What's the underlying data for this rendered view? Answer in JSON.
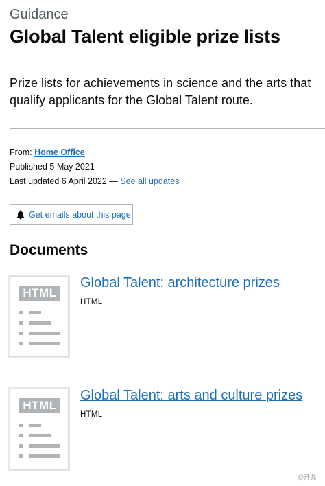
{
  "header": {
    "caption": "Guidance",
    "title": "Global Talent eligible prize lists",
    "lead": "Prize lists for achievements in science and the arts that qualify applicants for the Global Talent route."
  },
  "metadata": {
    "from_label": "From:",
    "from_link": "Home Office",
    "published_label": "Published",
    "published_date": "5 May 2021",
    "updated_label": "Last updated",
    "updated_date": "6 April 2022",
    "updated_separator": "—",
    "see_all_updates": "See all updates"
  },
  "email_button": {
    "icon": "bell-icon",
    "label": "Get emails about this page"
  },
  "documents": {
    "heading": "Documents",
    "thumbnail_badge": "HTML",
    "items": [
      {
        "title": "Global Talent: architecture prizes",
        "format": "HTML"
      },
      {
        "title": "Global Talent: arts and culture prizes",
        "format": "HTML"
      }
    ]
  },
  "watermark": "@开源"
}
